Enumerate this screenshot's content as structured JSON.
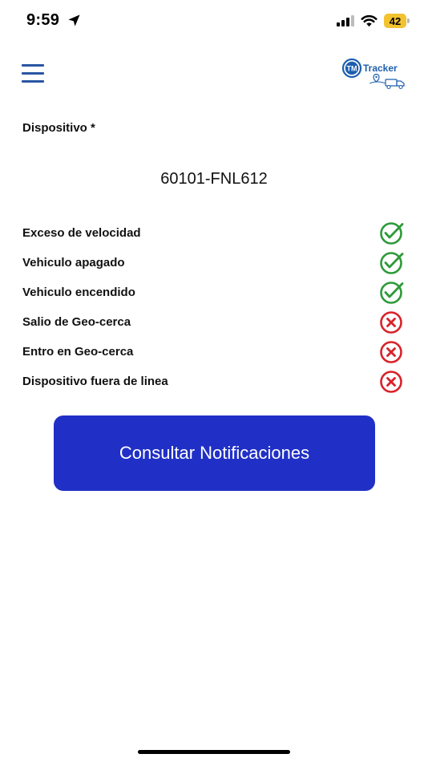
{
  "status_bar": {
    "time": "9:59",
    "battery": "42",
    "battery_color": "#f2c230",
    "icons": [
      "location-arrow-icon",
      "cellular-signal-icon",
      "wifi-icon",
      "battery-icon"
    ]
  },
  "header": {
    "menu_icon": "hamburger-menu-icon",
    "logo_badge": "TM",
    "logo_text": "Tracker",
    "logo_color": "#1d5fae"
  },
  "device": {
    "label": "Dispositivo *",
    "value": "60101-FNL612"
  },
  "notifications": [
    {
      "label": "Exceso de velocidad",
      "enabled": true
    },
    {
      "label": "Vehiculo apagado",
      "enabled": true
    },
    {
      "label": "Vehiculo encendido",
      "enabled": true
    },
    {
      "label": "Salio de Geo-cerca",
      "enabled": false
    },
    {
      "label": "Entro en Geo-cerca",
      "enabled": false
    },
    {
      "label": "Dispositivo fuera de linea",
      "enabled": false
    }
  ],
  "colors": {
    "enabled": "#2e9a3a",
    "disabled": "#d8232a",
    "button": "#2030c6"
  },
  "action": {
    "consult_label": "Consultar Notificaciones"
  }
}
